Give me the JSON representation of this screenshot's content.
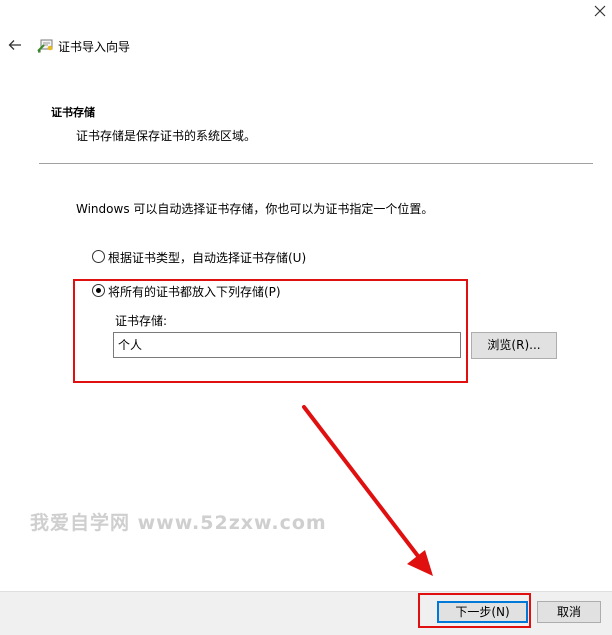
{
  "window": {
    "title": "证书导入向导",
    "close_icon": "close-icon",
    "back_icon": "back-arrow-icon",
    "wizard_icon": "certificate-wizard-icon"
  },
  "section": {
    "title": "证书存储",
    "description": "证书存储是保存证书的系统区域。"
  },
  "main": {
    "intro": "Windows 可以自动选择证书存储，你也可以为证书指定一个位置。",
    "options": [
      {
        "label": "根据证书类型，自动选择证书存储(U)",
        "selected": false
      },
      {
        "label": "将所有的证书都放入下列存储(P)",
        "selected": true
      }
    ],
    "store_label": "证书存储:",
    "store_value": "个人",
    "browse_label": "浏览(R)..."
  },
  "watermark": "我爱自学网 www.52zxw.com",
  "footer": {
    "next_label": "下一步(N)",
    "cancel_label": "取消"
  },
  "colors": {
    "annotation_red": "#e01010",
    "accent_blue": "#0078d7",
    "footer_bg": "#f0f0f0"
  }
}
